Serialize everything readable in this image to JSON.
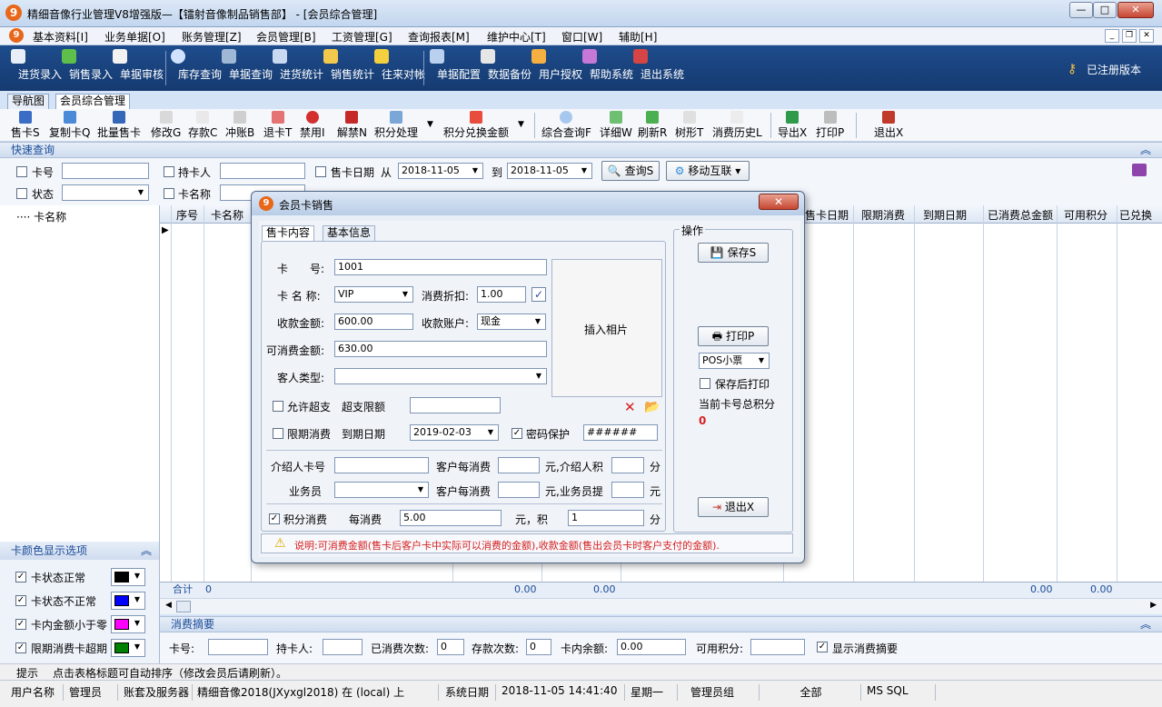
{
  "window": {
    "title": "精细音像行业管理V8增强版—【镭射音像制品销售部】 - [会员综合管理]",
    "min": "—",
    "max": "□",
    "close": "✕"
  },
  "menu": [
    "基本资料[I]",
    "业务单据[O]",
    "账务管理[Z]",
    "会员管理[B]",
    "工资管理[G]",
    "查询报表[M]",
    "维护中心[T]",
    "窗口[W]",
    "辅助[H]"
  ],
  "toolbar": {
    "items": [
      "进货录入",
      "销售录入",
      "单据审核",
      "库存查询",
      "单据查询",
      "进货统计",
      "销售统计",
      "往来对帐",
      "单据配置",
      "数据备份",
      "用户授权",
      "帮助系统",
      "退出系统"
    ],
    "registered": "已注册版本"
  },
  "tabs": [
    "导航图",
    "会员综合管理"
  ],
  "toolbar2": [
    "售卡S",
    "复制卡Q",
    "批量售卡",
    "修改G",
    "存款C",
    "冲账B",
    "退卡T",
    "禁用I",
    "解禁N",
    "积分处理",
    "积分兑换金额",
    "综合查询F",
    "详细W",
    "刷新R",
    "树形T",
    "消费历史L",
    "导出X",
    "打印P",
    "退出X"
  ],
  "quick": {
    "section": "快速查询",
    "card_no": "卡号",
    "status": "状态",
    "holder": "持卡人",
    "card_name": "卡名称",
    "sale_date": "售卡日期",
    "from": "从",
    "to": "到",
    "date_from": "2018-11-05",
    "date_to": "2018-11-05",
    "query_btn": "查询S",
    "mobile_btn": "移动互联",
    "customer_type": "客人类型"
  },
  "tree": {
    "root": "卡名称"
  },
  "grid": {
    "columns": [
      "序号",
      "卡名称",
      "售卡日期",
      "限期消费",
      "到期日期",
      "已消费总金额",
      "可用积分",
      "已兑换"
    ],
    "footer_label": "合计",
    "footer_values": [
      "0",
      "0.00",
      "0.00",
      "0.00",
      "0.00"
    ]
  },
  "color_panel": {
    "title": "卡颜色显示选项",
    "items": [
      {
        "label": "卡状态正常",
        "color": "#000000"
      },
      {
        "label": "卡状态不正常",
        "color": "#0000ff"
      },
      {
        "label": "卡内金额小于零",
        "color": "#ff00ff"
      },
      {
        "label": "限期消费卡超期",
        "color": "#008000"
      }
    ]
  },
  "summary": {
    "title": "消费摘要",
    "card_no": "卡号:",
    "holder": "持卡人:",
    "used_times": "已消费次数:",
    "used_times_val": "0",
    "deposit_times": "存款次数:",
    "deposit_times_val": "0",
    "balance": "卡内余额:",
    "balance_val": "0.00",
    "points": "可用积分:",
    "show_summary": "显示消费摘要"
  },
  "hint": {
    "label": "提示",
    "text": "点击表格标题可自动排序（修改会员后请刷新）。"
  },
  "statusbar": [
    "用户名称",
    "管理员",
    "账套及服务器",
    "精细音像2018(JXyxgl2018) 在 (local) 上",
    "系统日期",
    "2018-11-05  14:41:40",
    "星期一",
    "管理员组",
    "全部",
    "MS SQL"
  ],
  "dialog": {
    "title": "会员卡销售",
    "tabs": [
      "售卡内容",
      "基本信息"
    ],
    "card_no_label": "卡　　号:",
    "card_no": "1001",
    "card_name_label": "卡 名 称:",
    "card_name": "VIP",
    "discount_label": "消费折扣:",
    "discount": "1.00",
    "received_label": "收款金额:",
    "received": "600.00",
    "account_label": "收款账户:",
    "account": "现金",
    "spendable_label": "可消费金额:",
    "spendable": "630.00",
    "customer_type_label": "客人类型:",
    "photo": "插入相片",
    "overdraft_label": "允许超支",
    "overdraft_limit_label": "超支限额",
    "limited_label": "限期消费",
    "expire_label": "到期日期",
    "expire": "2019-02-03",
    "password_label": "密码保护",
    "password": "######",
    "referrer_label": "介绍人卡号",
    "per_spend1": "客户每消费",
    "unit1": "元,介绍人积",
    "fen1": "分",
    "staff_label": "业务员",
    "per_spend2": "客户每消费",
    "unit2": "元,业务员提",
    "yuan2": "元",
    "points_label": "积分消费",
    "each_spend": "每消费",
    "each_spend_val": "5.00",
    "unit3": "元，积",
    "points_val": "1",
    "fen3": "分",
    "ops_title": "操作",
    "save": "保存S",
    "print": "打印P",
    "print_type": "POS小票",
    "print_after_save": "保存后打印",
    "total_points_label": "当前卡号总积分",
    "total_points": "0",
    "exit": "退出X",
    "note": "说明:可消费金额(售卡后客户卡中实际可以消费的金额),收款金额(售出会员卡时客户支付的金额)."
  }
}
